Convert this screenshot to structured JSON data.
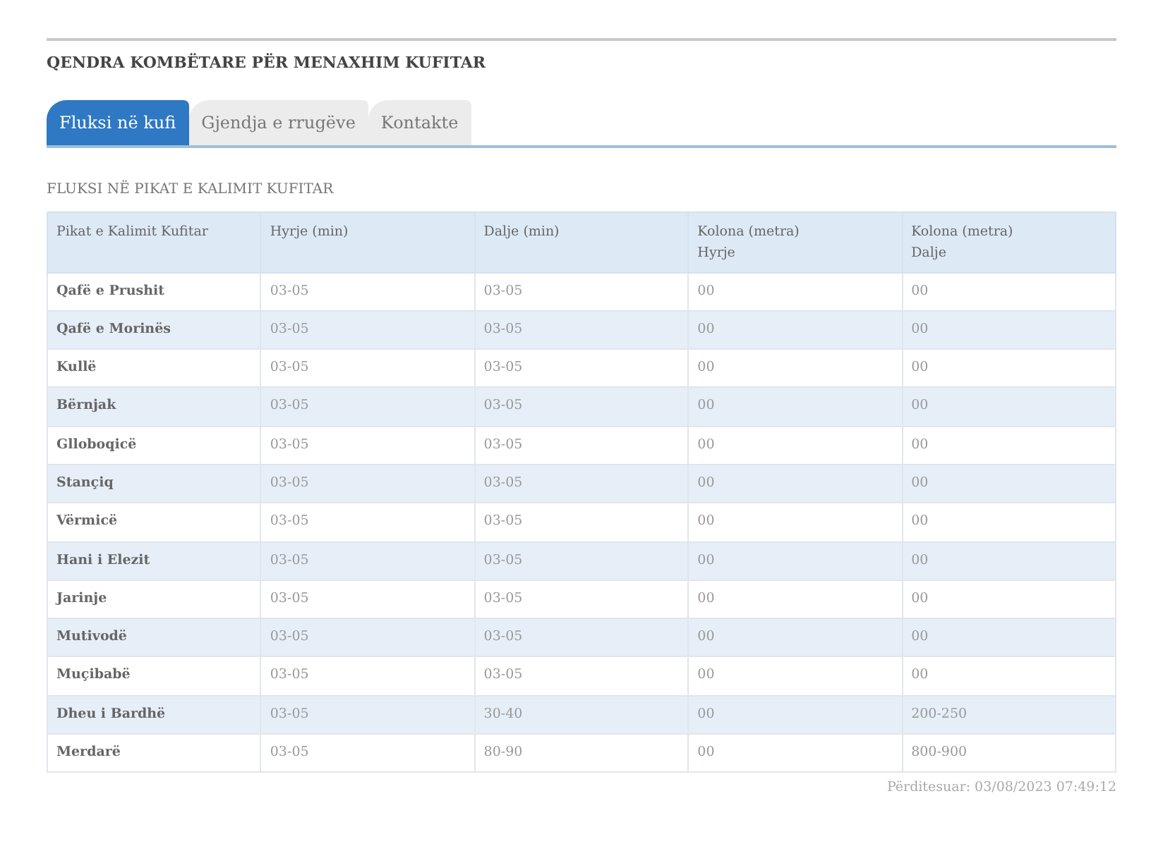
{
  "site_title": "QENDRA KOMBËTARE PËR MENAXHIM KUFITAR",
  "tabs": [
    {
      "label": "Fluksi në kufi",
      "selected": true
    },
    {
      "label": "Gjendja e rrugëve",
      "selected": false
    },
    {
      "label": "Kontakte",
      "selected": false
    }
  ],
  "section_title": "FLUKSI NË PIKAT E KALIMIT KUFITAR",
  "table": {
    "columns": [
      {
        "lines": [
          "Pikat e Kalimit Kufitar"
        ]
      },
      {
        "lines": [
          "Hyrje (min)"
        ]
      },
      {
        "lines": [
          "Dalje (min)"
        ]
      },
      {
        "lines": [
          "Kolona (metra)",
          "Hyrje"
        ]
      },
      {
        "lines": [
          "Kolona (metra)",
          "Dalje"
        ]
      }
    ],
    "rows": [
      [
        "Qafë e Prushit",
        "03-05",
        "03-05",
        "00",
        "00"
      ],
      [
        "Qafë e Morinës",
        "03-05",
        "03-05",
        "00",
        "00"
      ],
      [
        "Kullë",
        "03-05",
        "03-05",
        "00",
        "00"
      ],
      [
        "Bërnjak",
        "03-05",
        "03-05",
        "00",
        "00"
      ],
      [
        "Glloboqicë",
        "03-05",
        "03-05",
        "00",
        "00"
      ],
      [
        "Stançiq",
        "03-05",
        "03-05",
        "00",
        "00"
      ],
      [
        "Vërmicë",
        "03-05",
        "03-05",
        "00",
        "00"
      ],
      [
        "Hani i Elezit",
        "03-05",
        "03-05",
        "00",
        "00"
      ],
      [
        "Jarinje",
        "03-05",
        "03-05",
        "00",
        "00"
      ],
      [
        "Mutivodë",
        "03-05",
        "03-05",
        "00",
        "00"
      ],
      [
        "Muçibabë",
        "03-05",
        "03-05",
        "00",
        "00"
      ],
      [
        "Dheu i Bardhë",
        "03-05",
        "30-40",
        "00",
        "200-250"
      ],
      [
        "Merdarë",
        "03-05",
        "80-90",
        "00",
        "800-900"
      ]
    ]
  },
  "updated": "Përditesuar: 03/08/2023 07:49:12"
}
